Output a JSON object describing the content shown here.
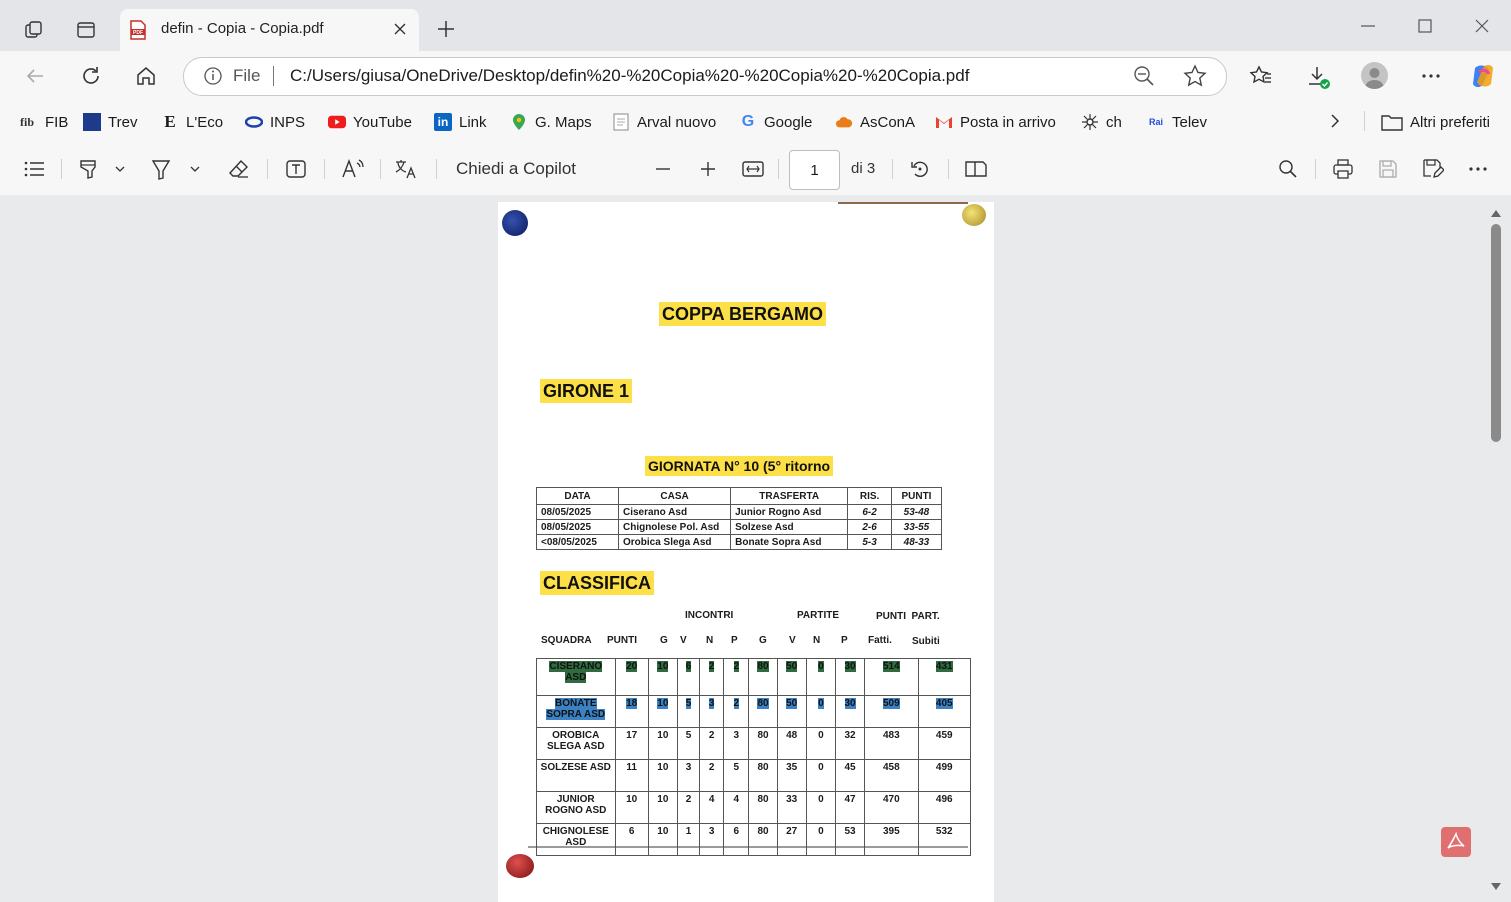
{
  "tab": {
    "title": "defin - Copia - Copia.pdf"
  },
  "address": {
    "scheme_label": "File",
    "url": "C:/Users/giusa/OneDrive/Desktop/defin%20-%20Copia%20-%20Copia%20-%20Copia.pdf"
  },
  "favorites": [
    {
      "label": "FIB",
      "icon": "fib-icon"
    },
    {
      "label": "Trev",
      "icon": "trev-icon"
    },
    {
      "label": "L'Eco",
      "icon": "leco-icon"
    },
    {
      "label": "INPS",
      "icon": "inps-icon"
    },
    {
      "label": "YouTube",
      "icon": "youtube-icon"
    },
    {
      "label": "Link",
      "icon": "linkedin-icon"
    },
    {
      "label": "G. Maps",
      "icon": "maps-pin-icon"
    },
    {
      "label": "Arval nuovo",
      "icon": "document-icon"
    },
    {
      "label": "Google",
      "icon": "google-icon"
    },
    {
      "label": "AsConA",
      "icon": "cloud-icon"
    },
    {
      "label": "Posta in arrivo",
      "icon": "gmail-icon"
    },
    {
      "label": "ch",
      "icon": "ch-icon"
    },
    {
      "label": "Telev",
      "icon": "telev-icon"
    }
  ],
  "other_favorites": "Altri preferiti",
  "pdf_toolbar": {
    "copilot": "Chiedi a Copilot",
    "page_current": "1",
    "page_of": "di 3"
  },
  "document": {
    "title": "COPPA BERGAMO",
    "group": "GIRONE 1",
    "matchday": "GIORNATA N° 10 (5° ritorno",
    "matches_header": [
      "DATA",
      "CASA",
      "TRASFERTA",
      "RIS.",
      "PUNTI"
    ],
    "matches": [
      [
        "08/05/2025",
        "Ciserano Asd",
        "Junior Rogno Asd",
        "6-2",
        "53-48"
      ],
      [
        "08/05/2025",
        "Chignolese Pol. Asd",
        "Solzese Asd",
        "2-6",
        "33-55"
      ],
      [
        "<08/05/2025",
        "Orobica Slega Asd",
        "Bonate Sopra Asd",
        "5-3",
        "48-33"
      ]
    ],
    "standings_title": "CLASSIFICA",
    "group_headers": {
      "incontri": "INCONTRI",
      "partite": "PARTITE",
      "punti_part": "PUNTI  PART."
    },
    "standings_header": [
      "SQUADRA",
      "PUNTI",
      "G",
      "V",
      "N",
      "P",
      "G",
      "V",
      "N",
      "P",
      "Fatti.",
      "Subiti"
    ],
    "standings": [
      {
        "team": "CISERANO ASD",
        "values": [
          "20",
          "10",
          "6",
          "2",
          "2",
          "80",
          "50",
          "0",
          "30",
          "514",
          "431"
        ],
        "highlight": "green"
      },
      {
        "team": "BONATE SOPRA ASD",
        "values": [
          "18",
          "10",
          "5",
          "3",
          "2",
          "80",
          "50",
          "0",
          "30",
          "509",
          "405"
        ],
        "highlight": "blue"
      },
      {
        "team": "OROBICA SLEGA ASD",
        "values": [
          "17",
          "10",
          "5",
          "2",
          "3",
          "80",
          "48",
          "0",
          "32",
          "483",
          "459"
        ],
        "highlight": "none"
      },
      {
        "team": "SOLZESE ASD",
        "values": [
          "11",
          "10",
          "3",
          "2",
          "5",
          "80",
          "35",
          "0",
          "45",
          "458",
          "499"
        ],
        "highlight": "none"
      },
      {
        "team": "JUNIOR ROGNO ASD",
        "values": [
          "10",
          "10",
          "2",
          "4",
          "4",
          "80",
          "33",
          "0",
          "47",
          "470",
          "496"
        ],
        "highlight": "none"
      },
      {
        "team": "CHIGNOLESE ASD",
        "values": [
          "6",
          "10",
          "1",
          "3",
          "6",
          "80",
          "27",
          "0",
          "53",
          "395",
          "532"
        ],
        "highlight": "none"
      }
    ]
  },
  "colors": {
    "highlight_yellow": "#fde047",
    "green_cell": "#2f6b3f",
    "blue_cell": "#3b82c4",
    "acrobat_red": "#e07070"
  }
}
